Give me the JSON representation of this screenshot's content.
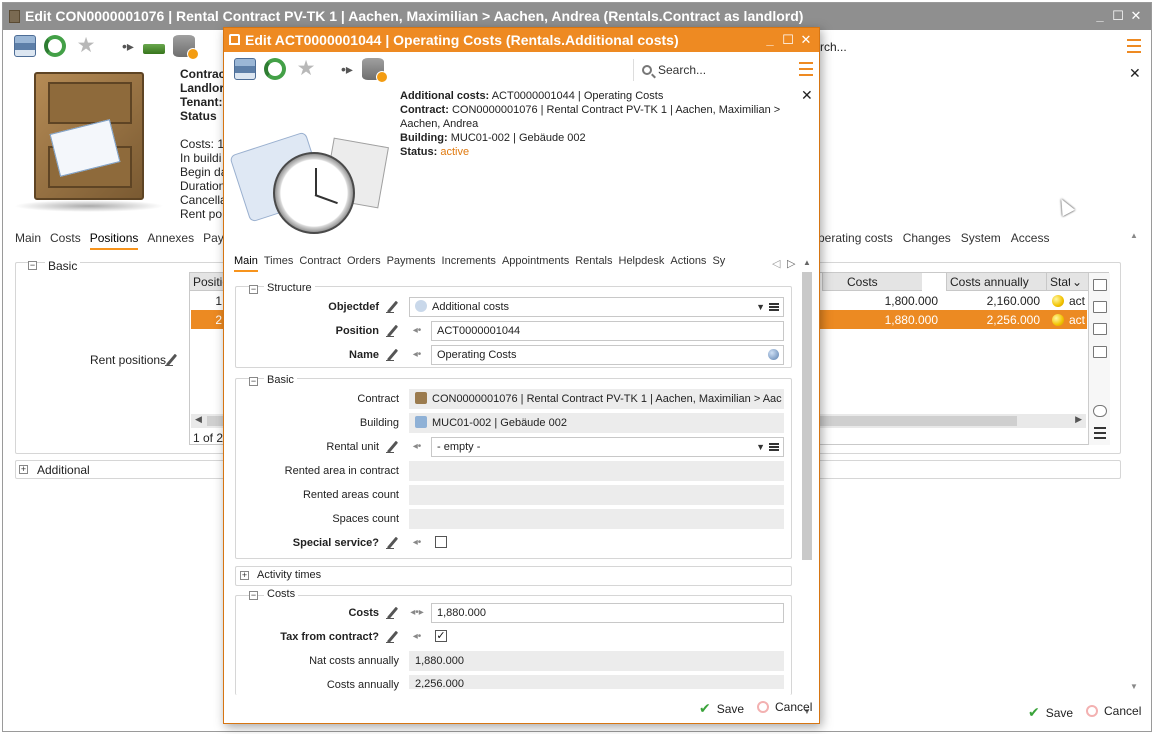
{
  "bg": {
    "title": "Edit CON0000001076 | Rental Contract PV-TK 1 | Aachen, Maximilian > Aachen, Andrea (Rentals.Contract as landlord)",
    "window_controls": [
      "_",
      "☐",
      "✕"
    ],
    "search_partial": "rch...",
    "close": "✕",
    "header_fields": {
      "contract": "Contrac",
      "landlord": "Landlor",
      "tenant": "Tenant:",
      "status": "Status",
      "costs": "Costs: 1",
      "in_building": "In buildi",
      "begin_date": "Begin da",
      "duration": "Duration",
      "cancellation": "Cancella",
      "rent_positions": "Rent po"
    },
    "tabs_left": [
      "Main",
      "Costs",
      "Positions",
      "Annexes",
      "Paym"
    ],
    "tabs_right": [
      "perating costs",
      "Changes",
      "System",
      "Access"
    ],
    "section_basic": "Basic",
    "section_additional": "Additional",
    "rent_positions_label": "Rent positions",
    "grid": {
      "col_position": "Positio",
      "col_costs": "Costs",
      "col_costs_annually": "Costs annually",
      "col_status": "Statu",
      "rows": [
        {
          "pos": "1",
          "costs": "1,800.000",
          "annually": "2,160.000",
          "status": "act"
        },
        {
          "pos": "2",
          "costs": "1,880.000",
          "annually": "2,256.000",
          "status": "act"
        }
      ],
      "pager": "1 of 2"
    },
    "save": "Save",
    "cancel": "Cancel"
  },
  "dlg": {
    "title": "Edit ACT0000001044 | Operating Costs (Rentals.Additional costs)",
    "window_controls": [
      "_",
      "☐",
      "✕"
    ],
    "search_placeholder": "Search...",
    "close": "✕",
    "info": {
      "additional_costs_label": "Additional costs:",
      "additional_costs_value": "ACT0000001044 | Operating Costs",
      "contract_label": "Contract:",
      "contract_value": "CON0000001076 | Rental Contract PV-TK 1 | Aachen, Maximilian >",
      "contract_value_2": "Aachen, Andrea",
      "building_label": "Building:",
      "building_value": "MUC01-002 | Gebäude 002",
      "status_label": "Status:",
      "status_value": "active"
    },
    "tabs": [
      "Main",
      "Times",
      "Contract",
      "Orders",
      "Payments",
      "Increments",
      "Appointments",
      "Rentals",
      "Helpdesk",
      "Actions",
      "Sy"
    ],
    "sections": {
      "structure": "Structure",
      "basic": "Basic",
      "activity_times": "Activity times",
      "costs": "Costs"
    },
    "fields": {
      "objectdef_label": "Objectdef",
      "objectdef_value": "Additional costs",
      "position_label": "Position",
      "position_value": "ACT0000001044",
      "name_label": "Name",
      "name_value": "Operating Costs",
      "contract_label": "Contract",
      "contract_value": "CON0000001076 | Rental Contract PV-TK 1 | Aachen, Maximilian > Aac",
      "building_label": "Building",
      "building_value": "MUC01-002 | Gebäude 002",
      "rental_unit_label": "Rental unit",
      "rental_unit_value": "- empty -",
      "rented_area_label": "Rented area in contract",
      "rented_count_label": "Rented areas count",
      "spaces_count_label": "Spaces count",
      "special_service_label": "Special service?",
      "costs_label": "Costs",
      "costs_value": "1,880.000",
      "tax_label": "Tax from contract?",
      "nat_costs_label": "Nat costs annually",
      "nat_costs_value": "1,880.000",
      "costs_annually_label": "Costs annually",
      "costs_annually_value": "2,256.000"
    },
    "save": "Save",
    "cancel": "Cancel"
  },
  "colors": {
    "accent": "#ee8a22",
    "bg_title": "#8f8f8f",
    "selected_row": "#ec8a22",
    "status_active": "#e07a10"
  }
}
